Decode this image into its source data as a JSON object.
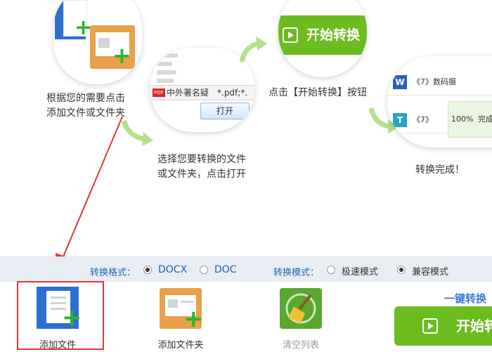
{
  "steps": {
    "step1": {
      "text_line1": "根据您的需要点击",
      "text_line2": "添加文件或文件夹"
    },
    "step2": {
      "text_line1": "选择您要转换的文件",
      "text_line2": "或文件夹，点击打开",
      "dialog_filename": "中外著名疑",
      "dialog_filter": "*.pdf;*.",
      "pdf_tag": "PDF",
      "open_label": "打开"
    },
    "step3": {
      "text": "点击【开始转换】按钮",
      "button_label": "开始转换"
    },
    "step4": {
      "text": "转换完成！",
      "row1": "《7》数码摄",
      "row2": "《7》",
      "word_letter": "W",
      "t_letter": "T",
      "percent": "100%",
      "done_label": "完成"
    }
  },
  "options": {
    "format_label": "转换格式：",
    "format_options": [
      "DOCX",
      "DOC"
    ],
    "format_selected": "DOCX",
    "mode_label": "转换模式：",
    "mode_options": [
      "极速模式",
      "兼容模式"
    ],
    "mode_selected": "兼容模式"
  },
  "toolbar": {
    "add_file": "添加文件",
    "add_folder": "添加文件夹",
    "clear_list": "清空列表",
    "one_key": "一键转换",
    "start": "开始转换"
  },
  "colors": {
    "green": "#6cbb1f",
    "blue_text": "#1e64b0",
    "highlight": "#e23636",
    "arrow_green": "#b5e08a"
  }
}
